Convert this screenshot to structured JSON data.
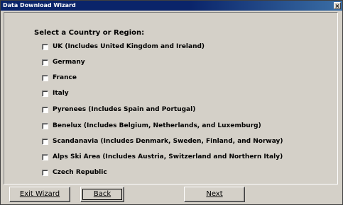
{
  "window": {
    "title": "Data Download Wizard",
    "close_glyph": "×"
  },
  "prompt": "Select a Country or Region:",
  "options": [
    "UK (Includes United Kingdom and Ireland)",
    "Germany",
    "France",
    "Italy",
    "Pyrenees (Includes Spain and Portugal)",
    "Benelux (Includes Belgium, Netherlands, and Luxemburg)",
    "Scandanavia (Includes Denmark, Sweden, Finland, and Norway)",
    "Alps Ski Area (Includes Austria, Switzerland and Northern Italy)",
    "Czech Republic"
  ],
  "buttons": {
    "exit": "Exit Wizard",
    "back": "Back",
    "next": "Next"
  }
}
